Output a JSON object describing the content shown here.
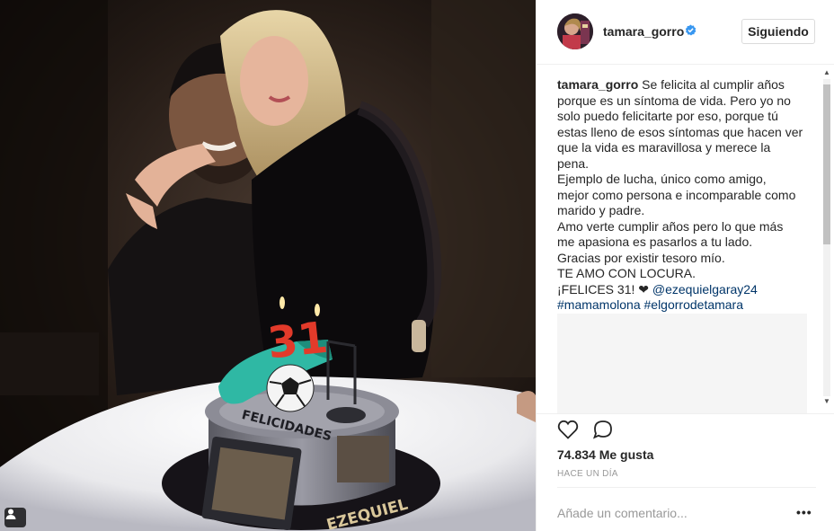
{
  "post": {
    "username": "tamara_gorro",
    "verified": true,
    "follow_label": "Siguiendo",
    "caption_lines": [
      "Se felicita al cumplir años",
      "porque es un síntoma de vida. Pero yo no",
      "solo puedo felicitarte por eso, porque tú",
      "estas lleno de esos síntomas que hacen ver",
      "que la vida es maravillosa y merece la pena.",
      "Ejemplo de lucha, único como amigo,",
      "mejor como persona e incomparable como",
      "marido y padre.",
      "Amo verte cumplir años pero lo que más",
      "me apasiona es pasarlos a tu lado.",
      "Gracias por existir tesoro mío.",
      "TE AMO CON LOCURA."
    ],
    "felices_text": "¡FELICES 31! ❤",
    "mention": "@ezequielgaray24",
    "hashtags": [
      "#mamamolona",
      "#elgorrodetamara"
    ],
    "likes": "74.834 Me gusta",
    "timestamp": "HACE UN DÍA",
    "comment_placeholder": "Añade un comentario...",
    "more_options": "•••"
  },
  "photo": {
    "cake_lettering": "FELICIDADES",
    "cake_name": "EZEQUIEL",
    "candles": "31"
  },
  "colors": {
    "link": "#003569",
    "text": "#262626",
    "muted": "#999999",
    "verified_blue": "#3897f0",
    "border": "#efefef"
  },
  "icons": {
    "verified": "verified-badge-icon",
    "like": "heart-icon",
    "comment": "comment-bubble-icon",
    "tag": "user-tag-icon",
    "more": "more-options-icon"
  }
}
